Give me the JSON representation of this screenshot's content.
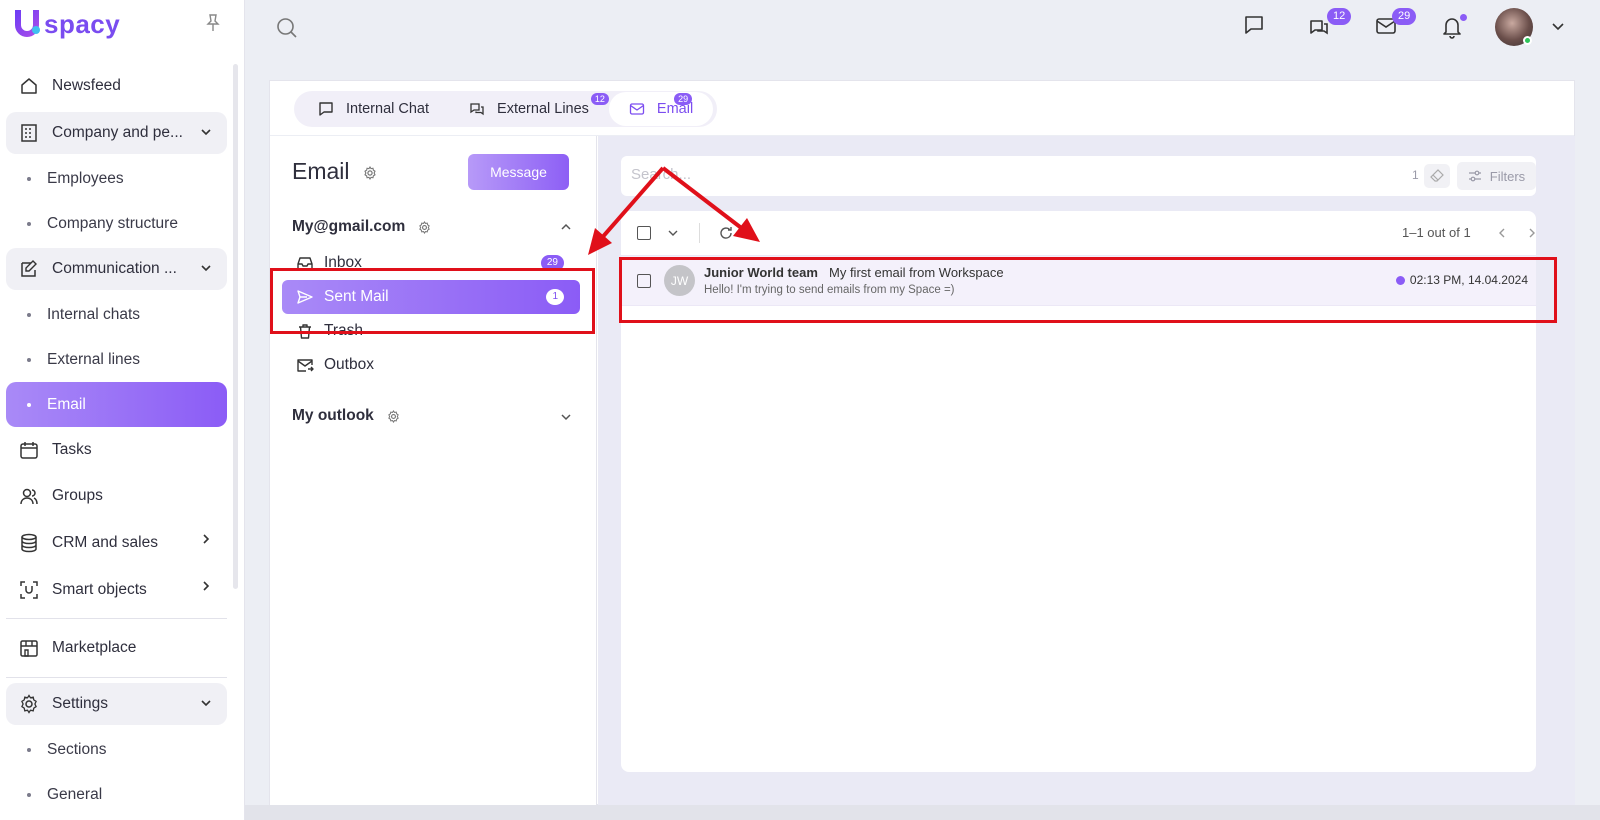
{
  "app": {
    "logo_text": "spacy"
  },
  "sidebar": {
    "items": [
      {
        "label": "Newsfeed",
        "icon": "home-icon"
      },
      {
        "label": "Company and pe...",
        "icon": "building-icon"
      },
      {
        "label": "Employees"
      },
      {
        "label": "Company structure"
      },
      {
        "label": "Communication ...",
        "icon": "communication-icon"
      },
      {
        "label": "Internal chats"
      },
      {
        "label": "External lines"
      },
      {
        "label": "Email"
      },
      {
        "label": "Tasks",
        "icon": "calendar-icon"
      },
      {
        "label": "Groups",
        "icon": "users-icon"
      },
      {
        "label": "CRM and sales",
        "icon": "database-icon"
      },
      {
        "label": "Smart objects",
        "icon": "scan-icon"
      },
      {
        "label": "Marketplace",
        "icon": "store-icon"
      },
      {
        "label": "Settings",
        "icon": "gear-icon"
      },
      {
        "label": "Sections"
      },
      {
        "label": "General"
      }
    ]
  },
  "topbar": {
    "chat_badge": "12",
    "mail_badge": "29"
  },
  "tabs": [
    {
      "label": "Internal Chat",
      "badge": ""
    },
    {
      "label": "External Lines",
      "badge": "12"
    },
    {
      "label": "Email",
      "badge": "29"
    }
  ],
  "email_panel": {
    "title": "Email",
    "message_button": "Message",
    "accounts": [
      {
        "name": "My@gmail.com",
        "folders": [
          {
            "label": "Inbox",
            "count": "29"
          },
          {
            "label": "Sent Mail",
            "count": "1"
          },
          {
            "label": "Trash",
            "count": ""
          },
          {
            "label": "Outbox",
            "count": ""
          }
        ]
      },
      {
        "name": "My outlook"
      }
    ]
  },
  "search": {
    "placeholder": "Search...",
    "count": "1",
    "filters_label": "Filters"
  },
  "list": {
    "pagination": "1–1 out of 1",
    "rows": [
      {
        "avatar": "JW",
        "sender": "Junior World team",
        "subject": "My first email from Workspace",
        "preview": "Hello! I'm trying to send emails from my Space =)",
        "time": "02:13 PM, 14.04.2024"
      }
    ]
  },
  "colors": {
    "accent": "#8b5cf6",
    "annotation": "#e0101a"
  }
}
